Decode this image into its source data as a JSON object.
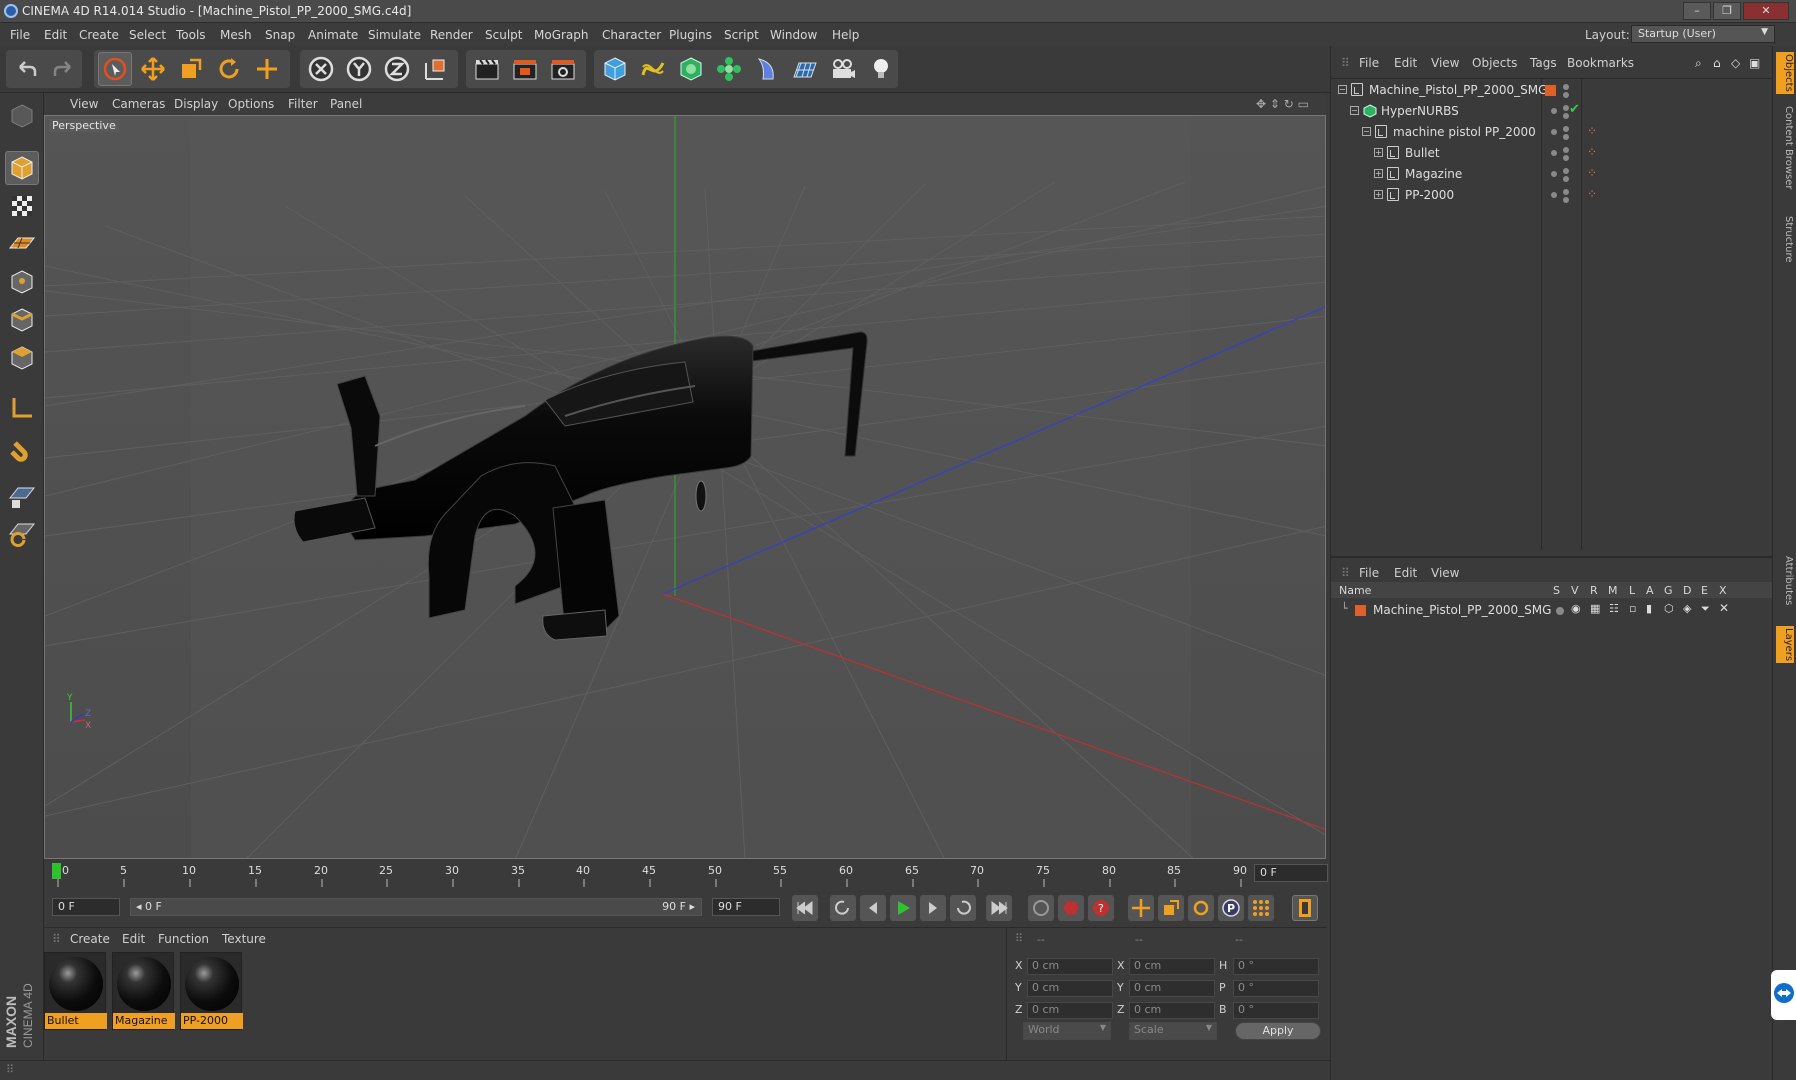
{
  "app": {
    "title": "CINEMA 4D R14.014 Studio - [Machine_Pistol_PP_2000_SMG.c4d]",
    "window_controls": [
      "minimize",
      "restore",
      "close"
    ]
  },
  "menubar": {
    "items": [
      "File",
      "Edit",
      "Create",
      "Select",
      "Tools",
      "Mesh",
      "Snap",
      "Animate",
      "Simulate",
      "Render",
      "Sculpt",
      "MoGraph",
      "Character",
      "Plugins",
      "Script",
      "Window",
      "Help"
    ],
    "layout_label": "Layout:",
    "layout_value": "Startup (User)"
  },
  "toolbar": {
    "icons": [
      "undo-icon",
      "redo-icon",
      "live-selection-icon",
      "move-icon",
      "scale-icon",
      "rotate-icon",
      "add-icon",
      "x-axis-icon",
      "y-axis-icon",
      "z-axis-icon",
      "coordinate-system-icon",
      "render-view-icon",
      "render-picture-viewer-icon",
      "edit-render-settings-icon",
      "cube-icon",
      "spline-icon",
      "nurbs-icon",
      "mograph-cloner-icon",
      "deformer-icon",
      "floor-icon",
      "camera-icon",
      "light-icon"
    ]
  },
  "left_toolbar": {
    "icons": [
      "make-editable-icon",
      "model-mode-icon",
      "texture-mode-icon",
      "workplane-mode-icon",
      "points-mode-icon",
      "edges-mode-icon",
      "polygons-mode-icon",
      "axis-mode-icon",
      "magnet-icon",
      "snap-lock-icon",
      "snap-settings-icon"
    ]
  },
  "viewport": {
    "menu": [
      "View",
      "Cameras",
      "Display",
      "Options",
      "Filter",
      "Panel"
    ],
    "label": "Perspective",
    "axis_labels": {
      "y": "Y",
      "z": "Z",
      "x": "X"
    }
  },
  "timeline": {
    "ticks": [
      "0",
      "5",
      "10",
      "15",
      "20",
      "25",
      "30",
      "35",
      "40",
      "45",
      "50",
      "55",
      "60",
      "65",
      "70",
      "75",
      "80",
      "85",
      "90"
    ],
    "current_frame": "0 F"
  },
  "transport": {
    "start_frame": "0 F",
    "range_start": "◂ 0 F",
    "range_end": "90 F ▸",
    "end_frame": "90 F",
    "buttons": [
      "go-to-start-icon",
      "go-to-previous-key-icon",
      "step-back-icon",
      "play-icon",
      "step-forward-icon",
      "go-to-next-key-icon",
      "go-to-end-icon",
      "record-active-objects-icon",
      "autokeying-icon",
      "keyframe-selection-icon",
      "position-key-icon",
      "scale-key-icon",
      "rotation-key-icon",
      "parameter-key-icon",
      "point-level-animation-icon",
      "timeline-icon"
    ]
  },
  "material_manager": {
    "menu": [
      "Create",
      "Edit",
      "Function",
      "Texture"
    ],
    "materials": [
      "Bullet",
      "Magazine",
      "PP-2000"
    ]
  },
  "coordinates": {
    "headers": [
      "--",
      "--",
      "--"
    ],
    "rows": [
      {
        "pos_label": "X",
        "pos": "0 cm",
        "size_label": "X",
        "size": "0 cm",
        "rot_label": "H",
        "rot": "0 °"
      },
      {
        "pos_label": "Y",
        "pos": "0 cm",
        "size_label": "Y",
        "size": "0 cm",
        "rot_label": "P",
        "rot": "0 °"
      },
      {
        "pos_label": "Z",
        "pos": "0 cm",
        "size_label": "Z",
        "size": "0 cm",
        "rot_label": "B",
        "rot": "0 °"
      }
    ],
    "space": "World",
    "mode": "Scale",
    "apply": "Apply"
  },
  "object_manager": {
    "menu": [
      "File",
      "Edit",
      "View",
      "Objects",
      "Tags",
      "Bookmarks"
    ],
    "objects": [
      {
        "name": "Machine_Pistol_PP_2000_SMG",
        "level": 0
      },
      {
        "name": "HyperNURBS",
        "level": 1
      },
      {
        "name": "machine pistol PP_2000",
        "level": 2
      },
      {
        "name": "Bullet",
        "level": 3
      },
      {
        "name": "Magazine",
        "level": 3
      },
      {
        "name": "PP-2000",
        "level": 3
      }
    ]
  },
  "layer_manager": {
    "menu": [
      "File",
      "Edit",
      "View"
    ],
    "columns": [
      "Name",
      "S",
      "V",
      "R",
      "M",
      "L",
      "A",
      "G",
      "D",
      "E",
      "X"
    ],
    "layers": [
      {
        "name": "Machine_Pistol_PP_2000_SMG",
        "color": "#e0602a"
      }
    ]
  },
  "right_tabs": [
    "Objects",
    "Content Browser",
    "Structure",
    "Attributes",
    "Layers"
  ],
  "branding": {
    "text": "MAXON CINEMA 4D"
  },
  "colors": {
    "accent": "#f0a020",
    "layer": "#e0602a",
    "play": "#2ec22e"
  }
}
